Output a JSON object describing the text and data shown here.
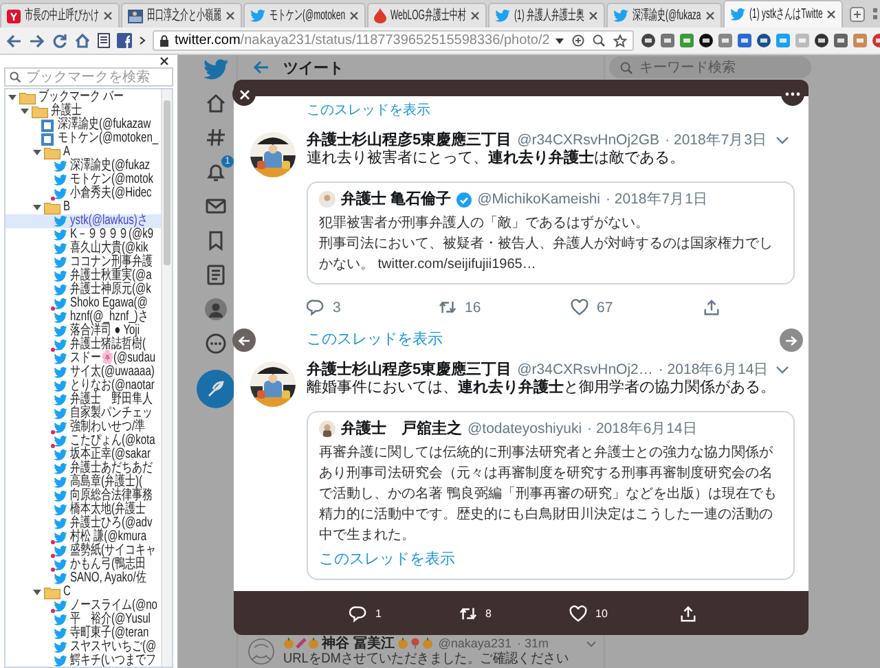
{
  "browser": {
    "tabs": [
      {
        "title": "市長の中止呼びかけ",
        "selected": false
      },
      {
        "title": "田口淳之介と小嶺麗",
        "selected": false
      },
      {
        "title": "モトケン(@motoken",
        "selected": false
      },
      {
        "title": "WebLOG弁護士中村",
        "selected": false
      },
      {
        "title": "(1) 弁護人弁護士奥",
        "selected": false
      },
      {
        "title": "深澤諭史(@fukaza",
        "selected": false
      },
      {
        "title": "(1) ystkさんはTwitte",
        "selected": true
      }
    ],
    "address_bar": {
      "host": "twitter.com",
      "path": "/nakaya231/status/1187739652515598336/photo/2"
    }
  },
  "bookmarks_panel": {
    "search": {
      "placeholder": "ブックマークを検索"
    },
    "tree": [
      {
        "kind": "folder",
        "label": "ブックマーク バー",
        "expanded": true,
        "children": [
          {
            "kind": "folder",
            "label": "弁護士",
            "expanded": true,
            "children": [
              {
                "kind": "page",
                "label": "深澤諭史(@fukazaw",
                "badge": false,
                "selected": false
              },
              {
                "kind": "page",
                "label": "モトケン(@motoken_",
                "badge": false,
                "selected": false
              },
              {
                "kind": "folder",
                "label": "A",
                "expanded": true,
                "children": [
                  {
                    "kind": "link",
                    "label": "深澤諭史(@fukaz",
                    "badge": false,
                    "selected": false
                  },
                  {
                    "kind": "link",
                    "label": "モトケン(@motok",
                    "badge": false,
                    "selected": false
                  },
                  {
                    "kind": "link",
                    "label": "小倉秀夫(@Hidec",
                    "badge": true,
                    "selected": false
                  }
                ]
              },
              {
                "kind": "folder",
                "label": "B",
                "expanded": true,
                "children": [
                  {
                    "kind": "link",
                    "label": "ystk(@lawkus)さ",
                    "badge": false,
                    "selected": true
                  },
                  {
                    "kind": "link",
                    "label": "K－９９９９(@k9",
                    "badge": false,
                    "selected": false
                  },
                  {
                    "kind": "link",
                    "label": "喜久山大貴(@kik",
                    "badge": false,
                    "selected": false
                  },
                  {
                    "kind": "link",
                    "label": "ココナン刑事弁護",
                    "badge": false,
                    "selected": false
                  },
                  {
                    "kind": "link",
                    "label": "弁護士秋重実(@a",
                    "badge": false,
                    "selected": false
                  },
                  {
                    "kind": "link",
                    "label": "弁護士神原元(@k",
                    "badge": false,
                    "selected": false
                  },
                  {
                    "kind": "link",
                    "label": "Shoko Egawa(@",
                    "badge": true,
                    "selected": false
                  },
                  {
                    "kind": "link",
                    "label": "hznf(@_hznf_)さ",
                    "badge": false,
                    "selected": false
                  },
                  {
                    "kind": "link",
                    "label": "落合洋司 ● Yoji",
                    "badge": false,
                    "selected": false
                  },
                  {
                    "kind": "link",
                    "label": "弁護士猪誌哲樹(",
                    "badge": true,
                    "selected": false
                  },
                  {
                    "kind": "link",
                    "label": "スドー🌸(@sudau",
                    "badge": false,
                    "selected": false
                  },
                  {
                    "kind": "link",
                    "label": "サイ太(@uwaaaa)",
                    "badge": false,
                    "selected": false
                  },
                  {
                    "kind": "link",
                    "label": "とりなお(@naotar",
                    "badge": false,
                    "selected": false
                  },
                  {
                    "kind": "link",
                    "label": "弁護士　野田隼人",
                    "badge": false,
                    "selected": false
                  },
                  {
                    "kind": "link",
                    "label": "自家製パンチェッ",
                    "badge": false,
                    "selected": false
                  },
                  {
                    "kind": "link",
                    "label": "強制わいせつ/準",
                    "badge": true,
                    "selected": false
                  },
                  {
                    "kind": "link",
                    "label": "こたぴょん(@kota",
                    "badge": true,
                    "selected": false
                  },
                  {
                    "kind": "link",
                    "label": "坂本正幸(@sakar",
                    "badge": false,
                    "selected": false
                  },
                  {
                    "kind": "link",
                    "label": "弁護士あだちあだ",
                    "badge": false,
                    "selected": false
                  },
                  {
                    "kind": "link",
                    "label": "高島章(弁護士)(",
                    "badge": false,
                    "selected": false
                  },
                  {
                    "kind": "link",
                    "label": "向原総合法律事務",
                    "badge": false,
                    "selected": false
                  },
                  {
                    "kind": "link",
                    "label": "橋本太地(弁護士",
                    "badge": false,
                    "selected": false
                  },
                  {
                    "kind": "link",
                    "label": "弁護士ひろ(@adv",
                    "badge": false,
                    "selected": false
                  },
                  {
                    "kind": "link",
                    "label": "村松 謙(@kmura",
                    "badge": true,
                    "selected": false
                  },
                  {
                    "kind": "link",
                    "label": "盛勢紙(サイコキャ",
                    "badge": true,
                    "selected": false
                  },
                  {
                    "kind": "link",
                    "label": "かもん弓(鴨志田",
                    "badge": true,
                    "selected": false
                  },
                  {
                    "kind": "link",
                    "label": "SANO, Ayako/佐",
                    "badge": false,
                    "selected": false
                  }
                ]
              },
              {
                "kind": "folder",
                "label": "C",
                "expanded": true,
                "children": [
                  {
                    "kind": "link",
                    "label": "ノースライム(@no",
                    "badge": true,
                    "selected": false
                  },
                  {
                    "kind": "link",
                    "label": "平　裕介(@Yusul",
                    "badge": false,
                    "selected": false
                  },
                  {
                    "kind": "link",
                    "label": "寺町東子(@teran",
                    "badge": false,
                    "selected": false
                  },
                  {
                    "kind": "link",
                    "label": "スヤスヤいちご(@",
                    "badge": false,
                    "selected": false
                  },
                  {
                    "kind": "link",
                    "label": "鰐キチ(いつまでフ",
                    "badge": false,
                    "selected": false
                  }
                ]
              }
            ]
          }
        ]
      }
    ]
  },
  "twitter": {
    "header": {
      "title": "ツイート"
    },
    "search": {
      "placeholder": "キーワード検索"
    },
    "notification_badge": "1",
    "background_tweet": {
      "name": "神谷 冨美江",
      "handle": "@nakaya231",
      "time": "· 31m",
      "text": "URLをDMさせていただきました。ご確認ください"
    }
  },
  "modal": {
    "top_link": "このスレッドを表示",
    "tweets": [
      {
        "name": "弁護士杉山程彦5東慶應三丁目",
        "handle": "@r34CXRsvHnOj2GB",
        "date": "· 2018年7月3日",
        "text": "連れ去り被害者にとって、**連れ去り弁護士**は敵である。",
        "quote": {
          "name": "弁護士 亀石倫子",
          "verified": true,
          "handle": "@MichikoKameishi",
          "date": "· 2018年7月1日",
          "paragraphs": [
            "犯罪被害者が刑事弁護人の「敵」であるはずがない。",
            "刑事司法において、被疑者・被告人、弁護人が対峙するのは国家権力でしかない。 twitter.com/seijifujii1965…"
          ]
        },
        "stats": {
          "replies": "3",
          "retweets": "16",
          "likes": "67"
        },
        "thread_link": "このスレッドを表示"
      },
      {
        "name": "弁護士杉山程彦5東慶應三丁目",
        "handle": "@r34CXRsvHnOj2…",
        "date": "· 2018年6月14日",
        "text": "離婚事件においては、**連れ去り弁護士**と御用学者の協力関係がある。",
        "quote": {
          "name": "弁護士　戸舘圭之",
          "verified": false,
          "handle": "@todateyoshiyuki",
          "date": "· 2018年6月14日",
          "paragraphs": [
            "再審弁護に関しては伝統的に刑事法研究者と弁護士との強力な協力関係があり刑事司法研究会（元々は再審制度を研究する刑事再審制度研究会の名で活動し、かの名著 鴨良弼編「刑事再審の研究」などを出版）は現在でも精力的に活動中です。歴史的にも白鳥財田川決定はこうした一連の活動の中で生まれた。"
          ],
          "link": "このスレッドを表示"
        }
      }
    ],
    "bar_stats": {
      "replies": "1",
      "retweets": "8",
      "likes": "10"
    }
  }
}
